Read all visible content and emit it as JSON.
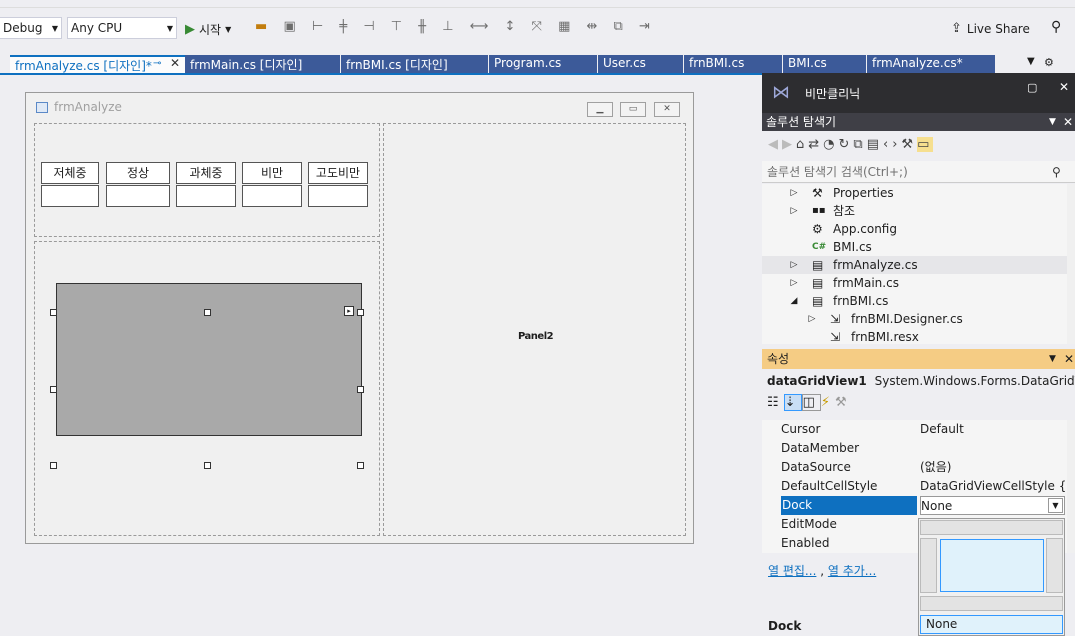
{
  "toolbar": {
    "config_select": "Debug",
    "platform_select": "Any CPU",
    "start_label": "시작",
    "live_share_label": "Live Share"
  },
  "tabs": [
    {
      "label": "frmAnalyze.cs [디자인]*"
    },
    {
      "label": "frmMain.cs [디자인]"
    },
    {
      "label": "frnBMI.cs [디자인]"
    },
    {
      "label": "Program.cs"
    },
    {
      "label": "User.cs"
    },
    {
      "label": "frnBMI.cs"
    },
    {
      "label": "BMI.cs"
    },
    {
      "label": "frmAnalyze.cs*"
    }
  ],
  "form": {
    "title": "frmAnalyze",
    "labels": [
      "저체중",
      "정상",
      "과체중",
      "비만",
      "고도비만"
    ],
    "panel2_label": "Panel2"
  },
  "side": {
    "window_title": "비만클리닉",
    "solution_explorer_title": "솔루션 탐색기",
    "search_placeholder": "솔루션 탐색기 검색(Ctrl+;)",
    "tree": [
      {
        "label": "Properties",
        "icon": "wrench-icon"
      },
      {
        "label": "참조",
        "icon": "references-icon"
      },
      {
        "label": "App.config",
        "icon": "config-file-icon"
      },
      {
        "label": "BMI.cs",
        "icon": "csharp-file-icon"
      },
      {
        "label": "frmAnalyze.cs",
        "icon": "form-icon"
      },
      {
        "label": "frmMain.cs",
        "icon": "form-icon"
      },
      {
        "label": "frnBMI.cs",
        "icon": "form-icon"
      },
      {
        "label": "frnBMI.Designer.cs",
        "icon": "designer-file-icon"
      },
      {
        "label": "frnBMI.resx",
        "icon": "resx-file-icon"
      }
    ],
    "properties_title": "속성",
    "object_name": "dataGridView1",
    "object_type": "System.Windows.Forms.DataGridView",
    "props": [
      {
        "name": "Cursor",
        "value": "Default"
      },
      {
        "name": "DataMember",
        "value": ""
      },
      {
        "name": "DataSource",
        "value": "(없음)"
      },
      {
        "name": "DefaultCellStyle",
        "value": "DataGridViewCellStyle { Ba"
      },
      {
        "name": "Dock",
        "value": "None"
      },
      {
        "name": "EditMode",
        "value": ""
      },
      {
        "name": "Enabled",
        "value": ""
      }
    ],
    "link_edit_columns": "열 편집...",
    "link_add_column": "열 추가...",
    "dock_desc_title": "Dock",
    "dock_none_label": "None"
  },
  "colors": {
    "accent": "#0e70c0",
    "tab_inactive": "#3c5a99",
    "selected_row": "#0e70c0",
    "highlight_tree": "#e6e6e9"
  }
}
